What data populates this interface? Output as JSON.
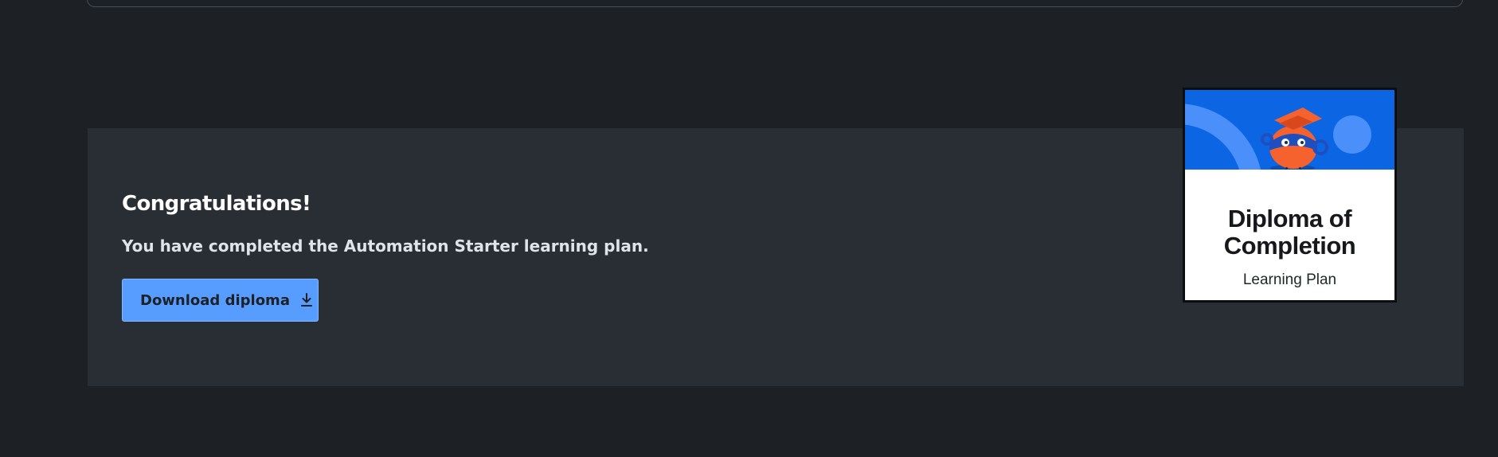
{
  "completion": {
    "title": "Congratulations!",
    "message": "You have completed the Automation Starter learning plan.",
    "download_button_label": "Download diploma",
    "download_icon": "download-icon"
  },
  "diploma": {
    "heading": "Diploma of Completion",
    "subtitle": "Learning Plan",
    "mascot": "graduation-mascot-illustration"
  },
  "colors": {
    "page_background": "#1d2125",
    "panel_background": "#282e33",
    "button_background": "#579dff",
    "diploma_banner": "#0c66e4",
    "mascot_orange": "#f5622e"
  }
}
